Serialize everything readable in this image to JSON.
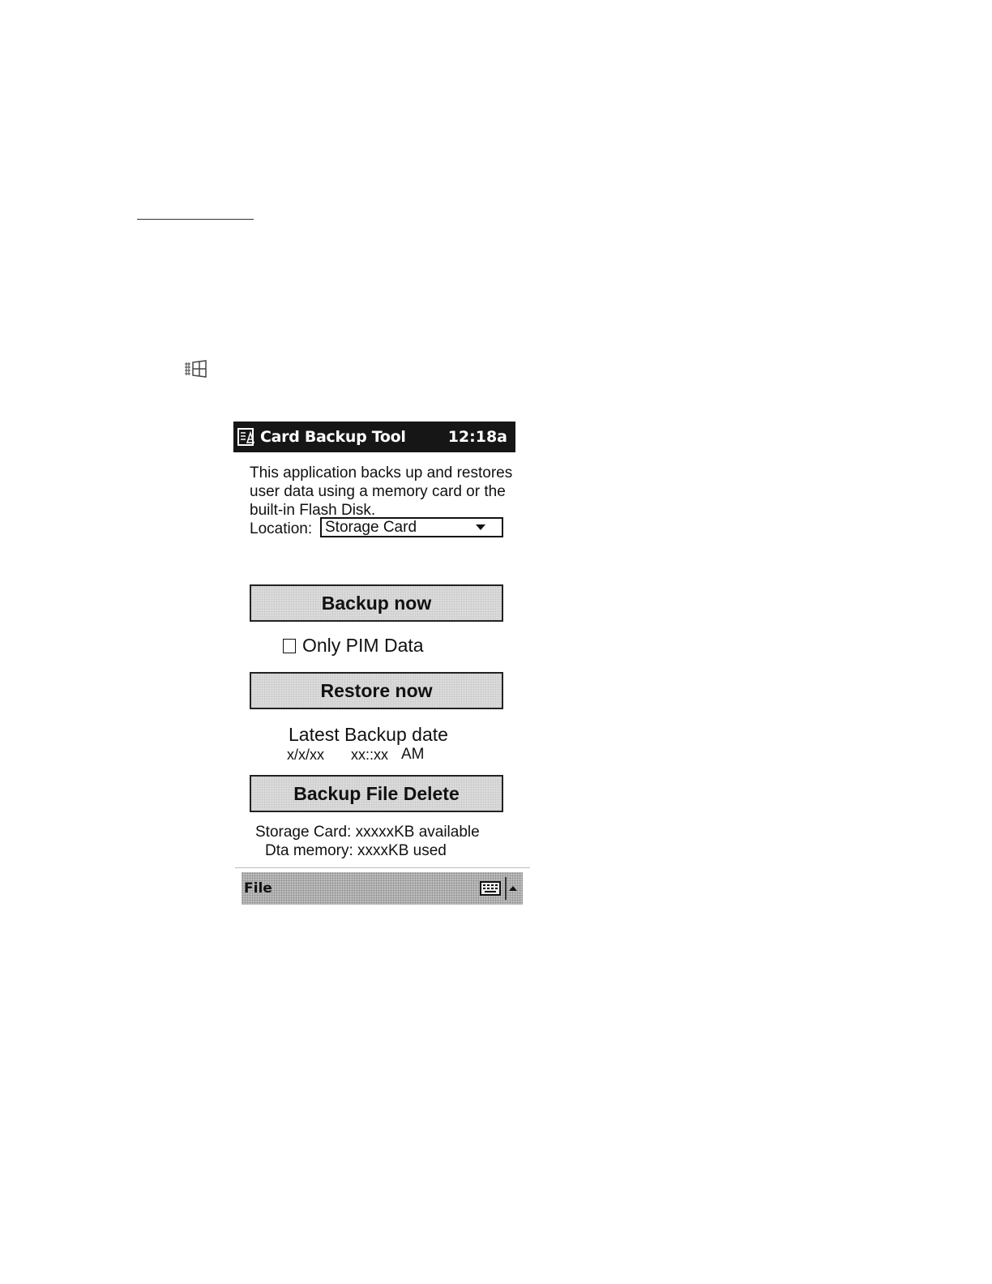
{
  "title_bar": {
    "app_title": "Card Backup Tool",
    "clock": "12:18a"
  },
  "description": "This application backs up and restores user data using a memory card or the built-in Flash Disk.",
  "location": {
    "label": "Location:",
    "selected": "Storage Card"
  },
  "buttons": {
    "backup": "Backup now",
    "restore": "Restore now",
    "delete": "Backup File Delete"
  },
  "checkbox": {
    "label": "Only PIM Data",
    "checked": false
  },
  "latest_backup": {
    "label": "Latest Backup date",
    "date": "x/x/xx",
    "time": "xx::xx",
    "ampm": "AM"
  },
  "storage": {
    "card_info": "Storage Card: xxxxxKB available",
    "memory_info": "Dta memory: xxxxKB used"
  },
  "menu_bar": {
    "file_label": "File"
  },
  "icons": {
    "start": "windows-start-icon",
    "app": "card-backup-app-icon",
    "keyboard": "keyboard-icon",
    "sip_arrow": "sip-up-arrow-icon"
  }
}
